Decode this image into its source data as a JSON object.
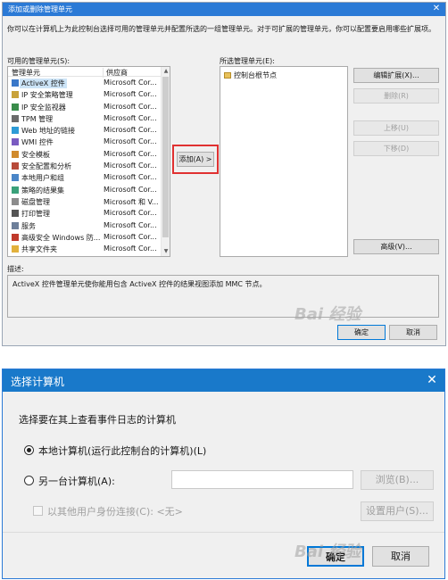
{
  "dialog1": {
    "title": "添加或删除管理单元",
    "intro": "你可以在计算机上为此控制台选择可用的管理单元并配置所选的一组管理单元。对于可扩展的管理单元，你可以配置要启用哪些扩展项。",
    "available_label": "可用的管理单元(S):",
    "columns": [
      "管理单元",
      "供应商"
    ],
    "available": [
      {
        "name": "ActiveX 控件",
        "vendor": "Microsoft Cor...",
        "icon": "activex-icon",
        "selected": true
      },
      {
        "name": "IP 安全策略管理",
        "vendor": "Microsoft Cor...",
        "icon": "ip-security-icon"
      },
      {
        "name": "IP 安全监视器",
        "vendor": "Microsoft Cor...",
        "icon": "ip-monitor-icon"
      },
      {
        "name": "TPM 管理",
        "vendor": "Microsoft Cor...",
        "icon": "tpm-icon"
      },
      {
        "name": "Web 地址的链接",
        "vendor": "Microsoft Cor...",
        "icon": "web-link-icon"
      },
      {
        "name": "WMI 控件",
        "vendor": "Microsoft Cor...",
        "icon": "wmi-icon"
      },
      {
        "name": "安全模板",
        "vendor": "Microsoft Cor...",
        "icon": "security-template-icon"
      },
      {
        "name": "安全配置和分析",
        "vendor": "Microsoft Cor...",
        "icon": "security-config-icon"
      },
      {
        "name": "本地用户和组",
        "vendor": "Microsoft Cor...",
        "icon": "users-groups-icon"
      },
      {
        "name": "策略的结果集",
        "vendor": "Microsoft Cor...",
        "icon": "policy-results-icon"
      },
      {
        "name": "磁盘管理",
        "vendor": "Microsoft 和 V...",
        "icon": "disk-icon"
      },
      {
        "name": "打印管理",
        "vendor": "Microsoft Cor...",
        "icon": "printer-icon"
      },
      {
        "name": "服务",
        "vendor": "Microsoft Cor...",
        "icon": "services-icon"
      },
      {
        "name": "高级安全 Windows 防...",
        "vendor": "Microsoft Cor...",
        "icon": "firewall-icon"
      },
      {
        "name": "共享文件夹",
        "vendor": "Microsoft Cor...",
        "icon": "shared-folder-icon"
      }
    ],
    "add_button": "添加(A) >",
    "selected_label": "所选管理单元(E):",
    "selected_items": [
      "控制台根节点"
    ],
    "edit_extensions": "编辑扩展(X)...",
    "remove": "删除(R)",
    "move_up": "上移(U)",
    "move_down": "下移(D)",
    "advanced": "高级(V)...",
    "description_label": "描述:",
    "description": "ActiveX 控件管理单元使你能用包含 ActiveX 控件的结果视图添加 MMC 节点。",
    "ok": "确定",
    "cancel": "取消",
    "watermark": "Bai 经验"
  },
  "dialog2": {
    "title": "选择计算机",
    "prompt": "选择要在其上查看事件日志的计算机",
    "local_option": "本地计算机(运行此控制台的计算机)(L)",
    "other_option": "另一台计算机(A):",
    "other_value": "",
    "browse": "浏览(B)...",
    "connect_as": "以其他用户身份连接(C): <无>",
    "set_user": "设置用户(S)...",
    "ok": "确定",
    "cancel": "取消",
    "watermark": "Bai 经验"
  },
  "colors": {
    "accent": "#2b7ad6",
    "highlight_frame": "#e03131"
  }
}
